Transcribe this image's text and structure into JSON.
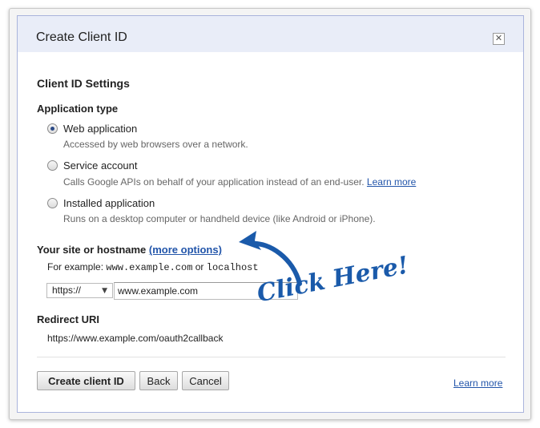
{
  "dialog": {
    "title": "Create Client ID",
    "close_icon": "close-icon",
    "settings_heading": "Client ID Settings",
    "app_type": {
      "heading": "Application type",
      "options": [
        {
          "label": "Web application",
          "description": "Accessed by web browsers over a network.",
          "selected": true
        },
        {
          "label": "Service account",
          "description": "Calls Google APIs on behalf of your application instead of an end-user.",
          "link": "Learn more",
          "selected": false
        },
        {
          "label": "Installed application",
          "description": "Runs on a desktop computer or handheld device (like Android or iPhone).",
          "selected": false
        }
      ]
    },
    "hostname": {
      "heading": "Your site or hostname",
      "more_options": "(more options)",
      "example_prefix": "For example:",
      "example_1": "www.example.com",
      "example_or": "or",
      "example_2": "localhost",
      "protocol": "https://",
      "value": "www.example.com"
    },
    "redirect": {
      "heading": "Redirect URI",
      "value": "https://www.example.com/oauth2callback"
    },
    "buttons": {
      "create": "Create client ID",
      "back": "Back",
      "cancel": "Cancel"
    },
    "footer_link": "Learn more"
  },
  "annotation": {
    "text": "Click Here!",
    "color": "#1a5aaa"
  }
}
